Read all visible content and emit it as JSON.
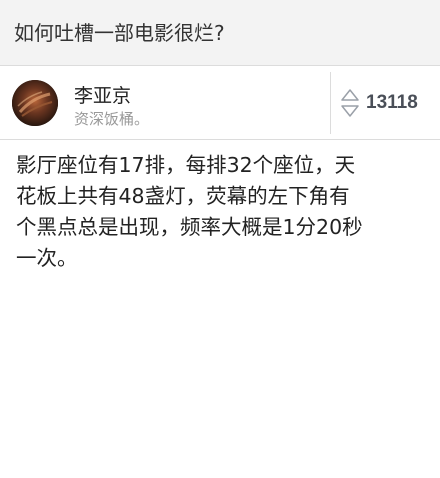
{
  "question": {
    "title": "如何吐槽一部电影很烂?"
  },
  "answer": {
    "author": {
      "name": "李亚京",
      "bio": "资深饭桶。",
      "avatar": "avatar-photo"
    },
    "votes": {
      "count": "13118",
      "icon": "vote-arrows-icon"
    },
    "body_lines": [
      "影厅座位有17排，每排32个座位，天",
      "花板上共有48盏灯，荧幕的左下角有",
      "个黑点总是出现，频率大概是1分20秒",
      "一次。"
    ]
  },
  "colors": {
    "header_bg": "#f3f3f3",
    "divider": "#dcdcdc",
    "muted_text": "#999999",
    "body_text": "#222222"
  }
}
